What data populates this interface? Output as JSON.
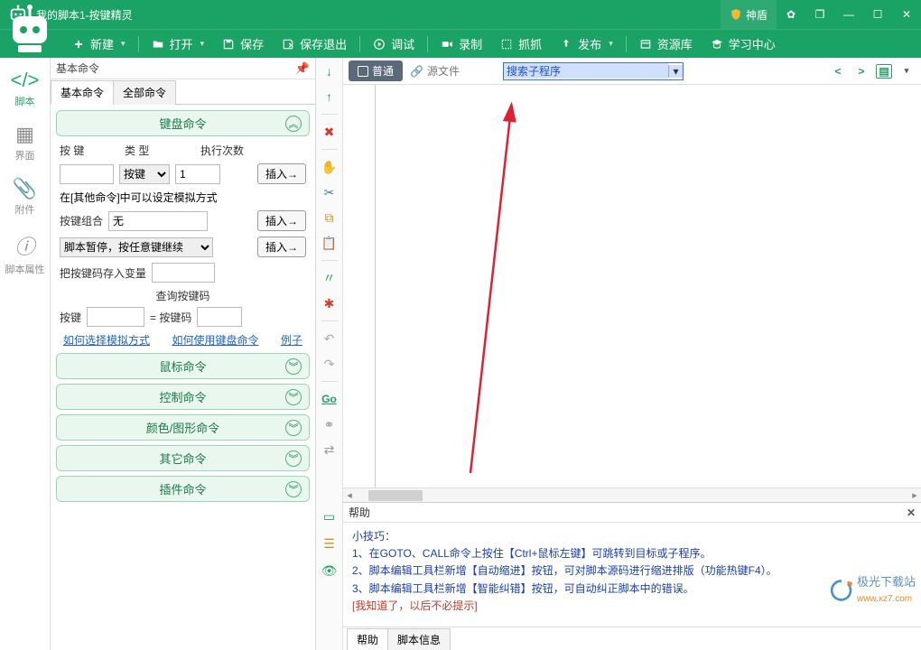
{
  "title": "我的脚本1-按键精灵",
  "shield": "神盾",
  "toolbar": {
    "new": "新建",
    "open": "打开",
    "save": "保存",
    "save_exit": "保存退出",
    "debug": "调试",
    "record": "录制",
    "grab": "抓抓",
    "publish": "发布",
    "resources": "资源库",
    "school": "学习中心"
  },
  "rail": {
    "script": "脚本",
    "ui": "界面",
    "attach": "附件",
    "props": "脚本属性"
  },
  "cmd": {
    "header": "基本命令",
    "tabs": [
      "基本命令",
      "全部命令"
    ],
    "keyboard": "键盘命令",
    "labels": {
      "key": "按 键",
      "type": "类 型",
      "times": "执行次数"
    },
    "type_option": "按键",
    "insert": "插入→",
    "note1": "在[其他命令]中可以设定模拟方式",
    "combo": "按键组合",
    "combo_val": "无",
    "pause": "脚本暂停，按任意键继续",
    "save_var": "把按键码存入变量",
    "query": "查询按键码",
    "key2": "按键",
    "eq": "= 按键码",
    "links": [
      "如何选择模拟方式",
      "如何使用键盘命令",
      "例子"
    ],
    "sections": [
      "鼠标命令",
      "控制命令",
      "颜色/图形命令",
      "其它命令",
      "插件命令"
    ]
  },
  "editor": {
    "mode_normal": "普通",
    "mode_source": "源文件",
    "search": "搜索子程序"
  },
  "help": {
    "title": "帮助",
    "tip_header": "小技巧：",
    "lines": [
      "1、在GOTO、CALL命令上按住【Ctrl+鼠标左键】可跳转到目标或子程序。",
      "2、脚本编辑工具栏新增【自动缩进】按钮，可对脚本源码进行缩进排版（功能热键F4）。",
      "3、脚本编辑工具栏新增【智能纠错】按钮，可自动纠正脚本中的错误。"
    ],
    "dismiss": "[我知道了，以后不必提示]",
    "tabs": [
      "帮助",
      "脚本信息"
    ]
  },
  "watermark": {
    "name": "极光下载站",
    "url": "www.xz7.com"
  }
}
